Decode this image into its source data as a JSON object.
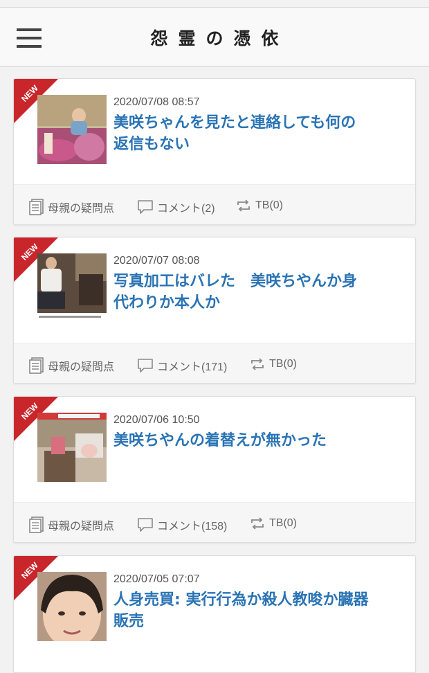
{
  "header": {
    "site_title": "怨霊の憑依"
  },
  "posts": [
    {
      "badge": "NEW",
      "date": "2020/07/08 08:57",
      "title_lines": [
        "美咲ちゃんを見たと連絡しても何の",
        "返信もない"
      ],
      "category": "母親の疑問点",
      "comments": "コメント(2)",
      "trackbacks": "TB(0)"
    },
    {
      "badge": "NEW",
      "date": "2020/07/07 08:08",
      "title_lines": [
        "写真加工はバレた　美咲ちやんか身",
        "代わりか本人か"
      ],
      "category": "母親の疑問点",
      "comments": "コメント(171)",
      "trackbacks": "TB(0)"
    },
    {
      "badge": "NEW",
      "date": "2020/07/06 10:50",
      "title_lines": [
        "美咲ちやんの着替えが無かった"
      ],
      "category": "母親の疑問点",
      "comments": "コメント(158)",
      "trackbacks": "TB(0)"
    },
    {
      "badge": "NEW",
      "date": "2020/07/05 07:07",
      "title_lines": [
        "人身売買: 実行行為か殺人教唆か臓器",
        "販売"
      ],
      "category": "",
      "comments": "",
      "trackbacks": ""
    }
  ],
  "colors": {
    "title_link": "#2a73b5",
    "ribbon": "#c9262c"
  }
}
